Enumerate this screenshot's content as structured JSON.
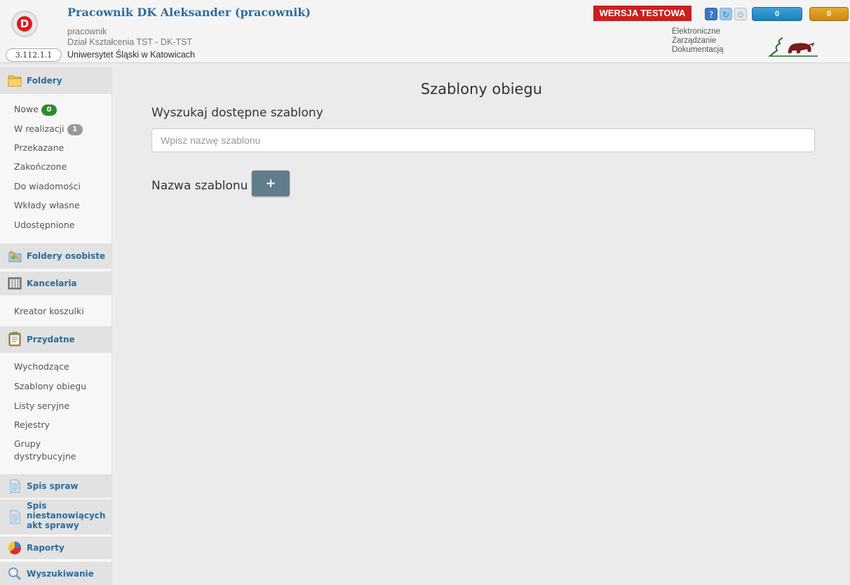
{
  "header": {
    "user_name": "Pracownik DK Aleksander (pracownik)",
    "role": "pracownik",
    "department": "Dział Kształcenia TST - DK-TST",
    "university": "Uniwersytet Śląski w Katowicach",
    "version": "3.112.1.1",
    "test_badge": "WERSJA TESTOWA",
    "counter_blue": "0",
    "counter_yellow": "0",
    "ezd_line1": "Elektroniczne",
    "ezd_line2": "Zarządzanie",
    "ezd_line3": "Dokumentacją",
    "help_icon": "question-icon",
    "refresh_icon": "refresh-icon",
    "settings_icon": "gear-icon"
  },
  "sidebar": {
    "folders": {
      "title": "Foldery",
      "items": [
        {
          "label": "Nowe",
          "badge": "0"
        },
        {
          "label": "W realizacji",
          "badge": "1"
        },
        {
          "label": "Przekazane"
        },
        {
          "label": "Zakończone"
        },
        {
          "label": "Do wiadomości"
        },
        {
          "label": "Wkłady własne"
        },
        {
          "label": "Udostępnione"
        }
      ]
    },
    "personal": {
      "title": "Foldery osobiste"
    },
    "office": {
      "title": "Kancelaria",
      "items": [
        {
          "label": "Kreator koszulki"
        }
      ]
    },
    "useful": {
      "title": "Przydatne",
      "items": [
        {
          "label": "Wychodzące"
        },
        {
          "label": "Szablony obiegu"
        },
        {
          "label": "Listy seryjne"
        },
        {
          "label": "Rejestry"
        },
        {
          "label": "Grupy dystrybucyjne"
        }
      ]
    },
    "cases": {
      "title": "Spis spraw"
    },
    "acts": {
      "title_line1": "Spis",
      "title_line2": "niestanowiących",
      "title_line3": "akt sprawy"
    },
    "reports": {
      "title": "Raporty"
    },
    "search": {
      "title": "Wyszukiwanie"
    }
  },
  "main": {
    "title": "Szablony obiegu",
    "search_label": "Wyszukaj dostępne szablony",
    "search_placeholder": "Wpisz nazwę szablonu",
    "search_value": "",
    "name_label": "Nazwa szablonu",
    "add_label": "+"
  },
  "colors": {
    "accent": "#2b6d9d",
    "test_badge": "#cc1f1f",
    "add_button": "#607d8b",
    "badge_green": "#2e8b2e"
  }
}
